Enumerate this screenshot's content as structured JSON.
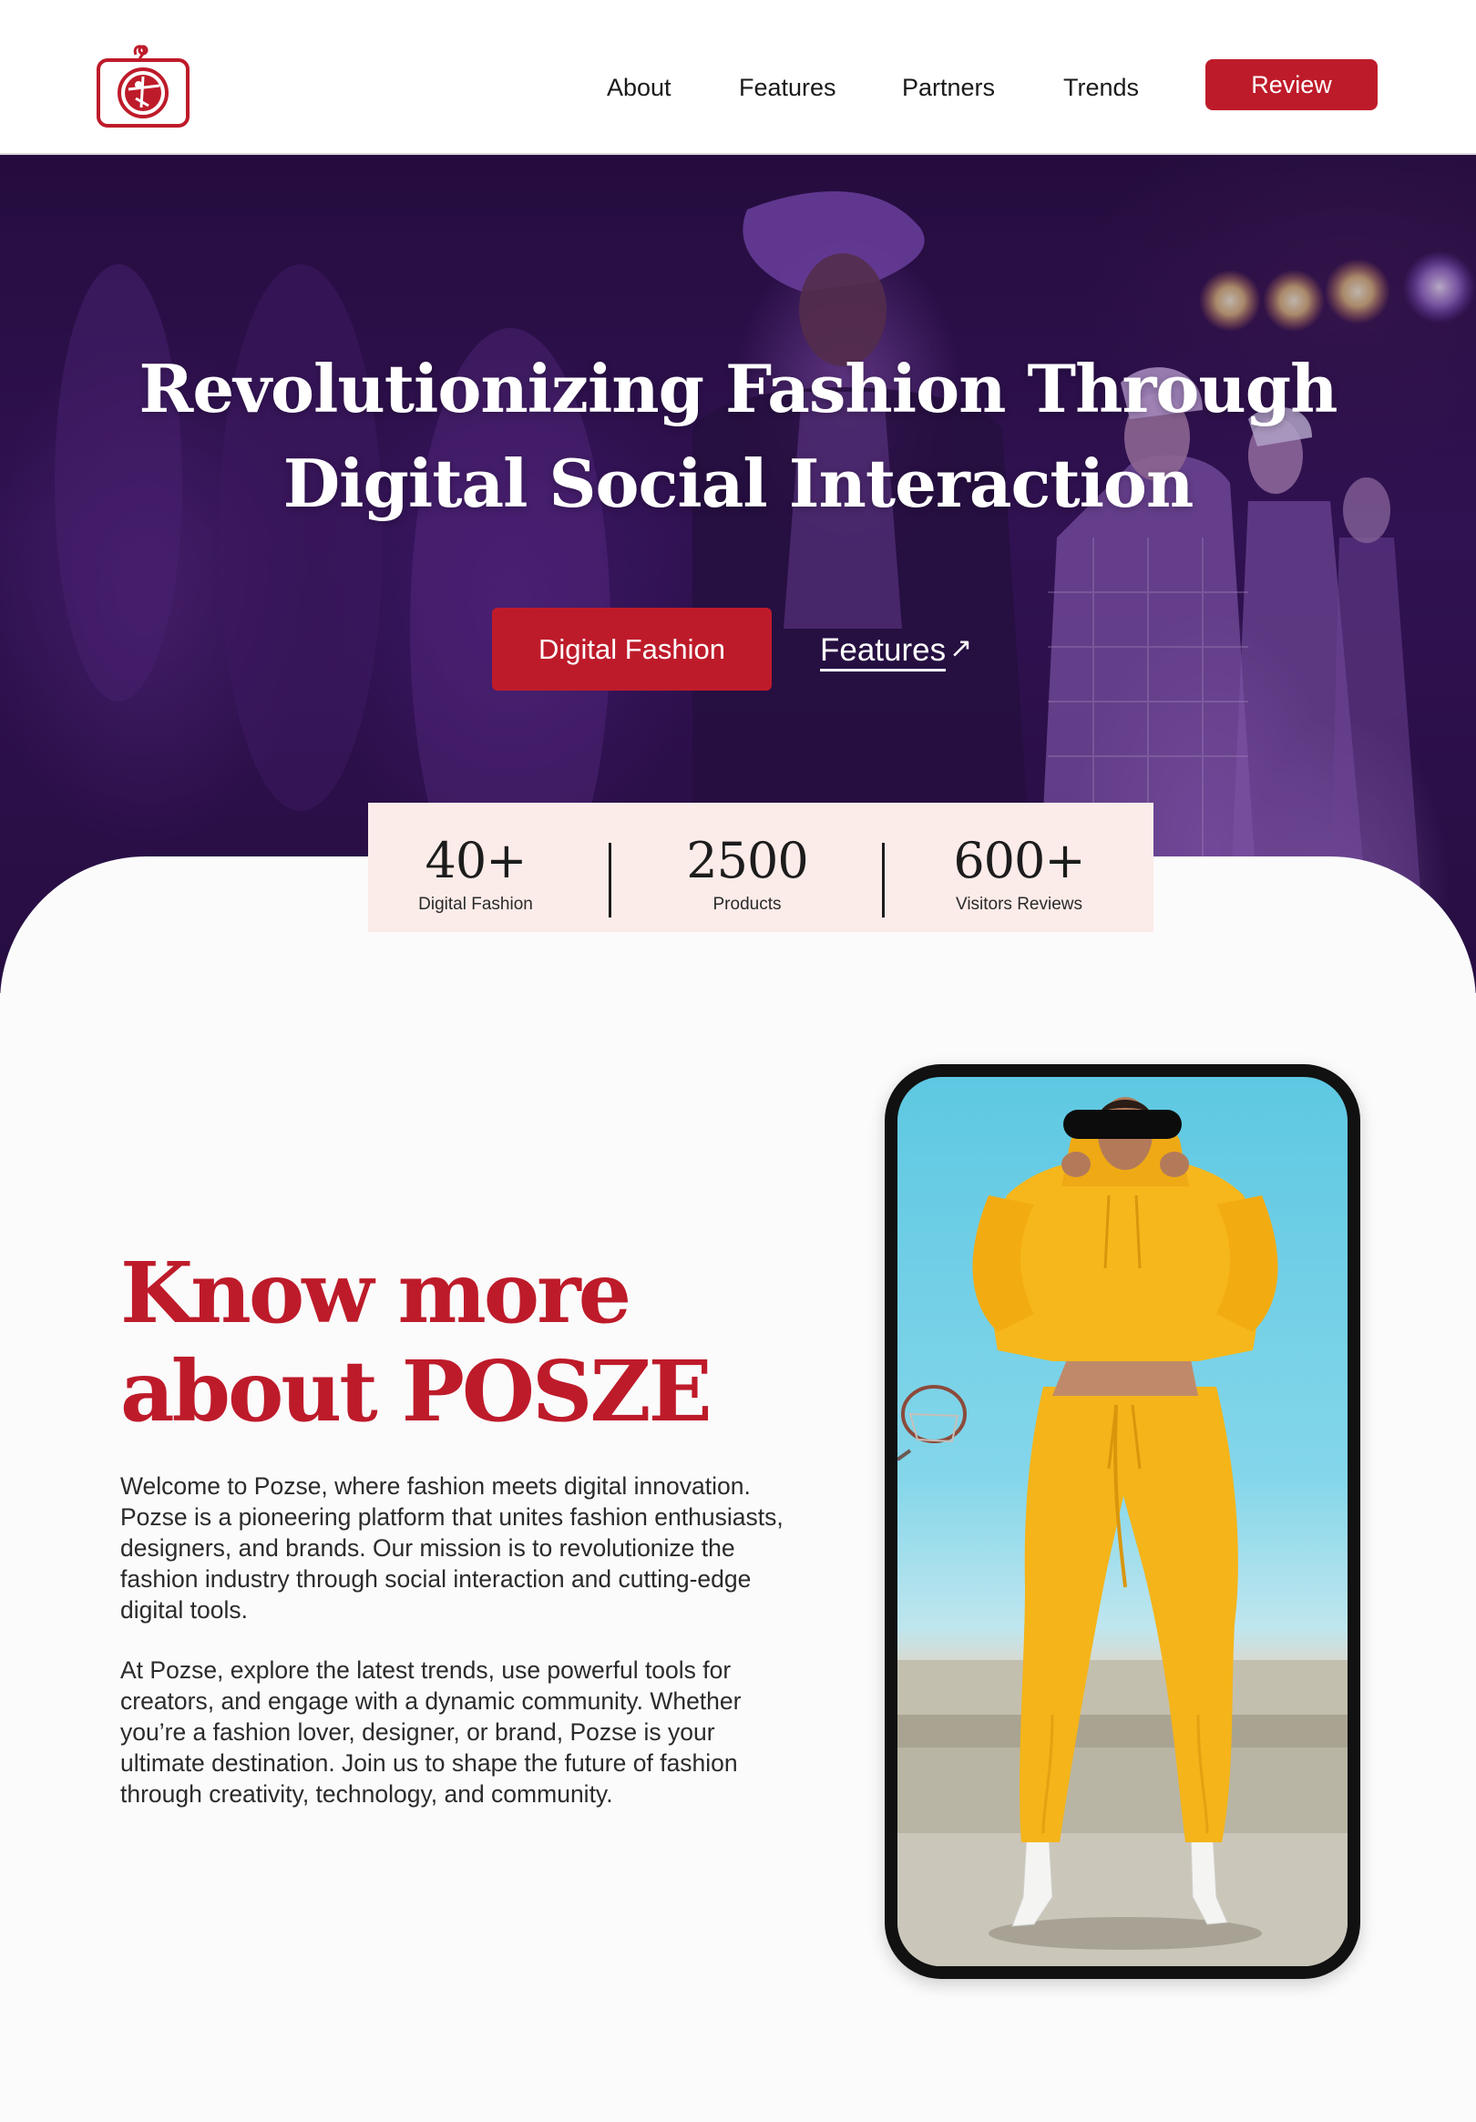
{
  "header": {
    "logo_icon": "camera-logo-icon",
    "nav": [
      {
        "label": "About"
      },
      {
        "label": "Features"
      },
      {
        "label": "Partners"
      },
      {
        "label": "Trends"
      }
    ],
    "review_label": "Review"
  },
  "hero": {
    "title_line1": "Revolutionizing Fashion Through",
    "title_line2": "Digital Social Interaction",
    "primary_button": "Digital Fashion",
    "secondary_link": "Features",
    "secondary_link_icon": "arrow-up-right-icon"
  },
  "stats": [
    {
      "value": "40+",
      "label": "Digital Fashion"
    },
    {
      "value": "2500",
      "label": "Products"
    },
    {
      "value": "600+",
      "label": "Visitors Reviews"
    }
  ],
  "about": {
    "heading_line1": "Know more",
    "heading_line2": "about POSZE",
    "paragraph1": "Welcome to Pozse, where fashion meets digital innovation. Pozse is a pioneering platform that unites fashion enthusiasts, designers, and brands. Our mission is to revolutionize the fashion industry through social interaction and cutting-edge digital tools.",
    "paragraph2": "At Pozse, explore the latest trends, use powerful tools for creators, and engage with a dynamic community. Whether you’re a fashion lover, designer, or brand, Pozse is your ultimate destination. Join us to shape the future of fashion through creativity, technology, and community."
  },
  "colors": {
    "brand_red": "#be1b2a",
    "hero_purple": "#3a1660",
    "stats_bg": "#fcece9"
  }
}
